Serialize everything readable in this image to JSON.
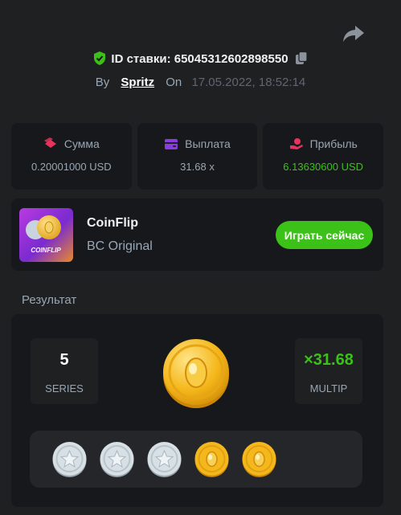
{
  "header": {
    "bet_id": "ID ставки: 65045312602898550",
    "by_label": "By",
    "username": "Spritz",
    "on_label": "On",
    "datetime": "17.05.2022, 18:52:14"
  },
  "stats": [
    {
      "label": "Сумма",
      "value": "0.20001000 USD",
      "icon": "stack-icon"
    },
    {
      "label": "Выплата",
      "value": "31.68 x",
      "icon": "wallet-icon"
    },
    {
      "label": "Прибыль",
      "value": "6.13630600 USD",
      "icon": "hand-coin-icon"
    }
  ],
  "game": {
    "name": "CoinFlip",
    "provider": "BC Original",
    "thumb_text": "COINFLIP",
    "play_label": "Играть сейчас"
  },
  "result": {
    "section_label": "Результат",
    "series_value": "5",
    "series_label": "SERIES",
    "multip_value": "×31.68",
    "multip_label": "MULTIP",
    "coins": [
      "silver",
      "silver",
      "silver",
      "gold",
      "gold"
    ]
  },
  "colors": {
    "accent_green": "#3bc117",
    "background": "#1f2022",
    "card": "#17181b",
    "muted": "#98a7b5"
  }
}
